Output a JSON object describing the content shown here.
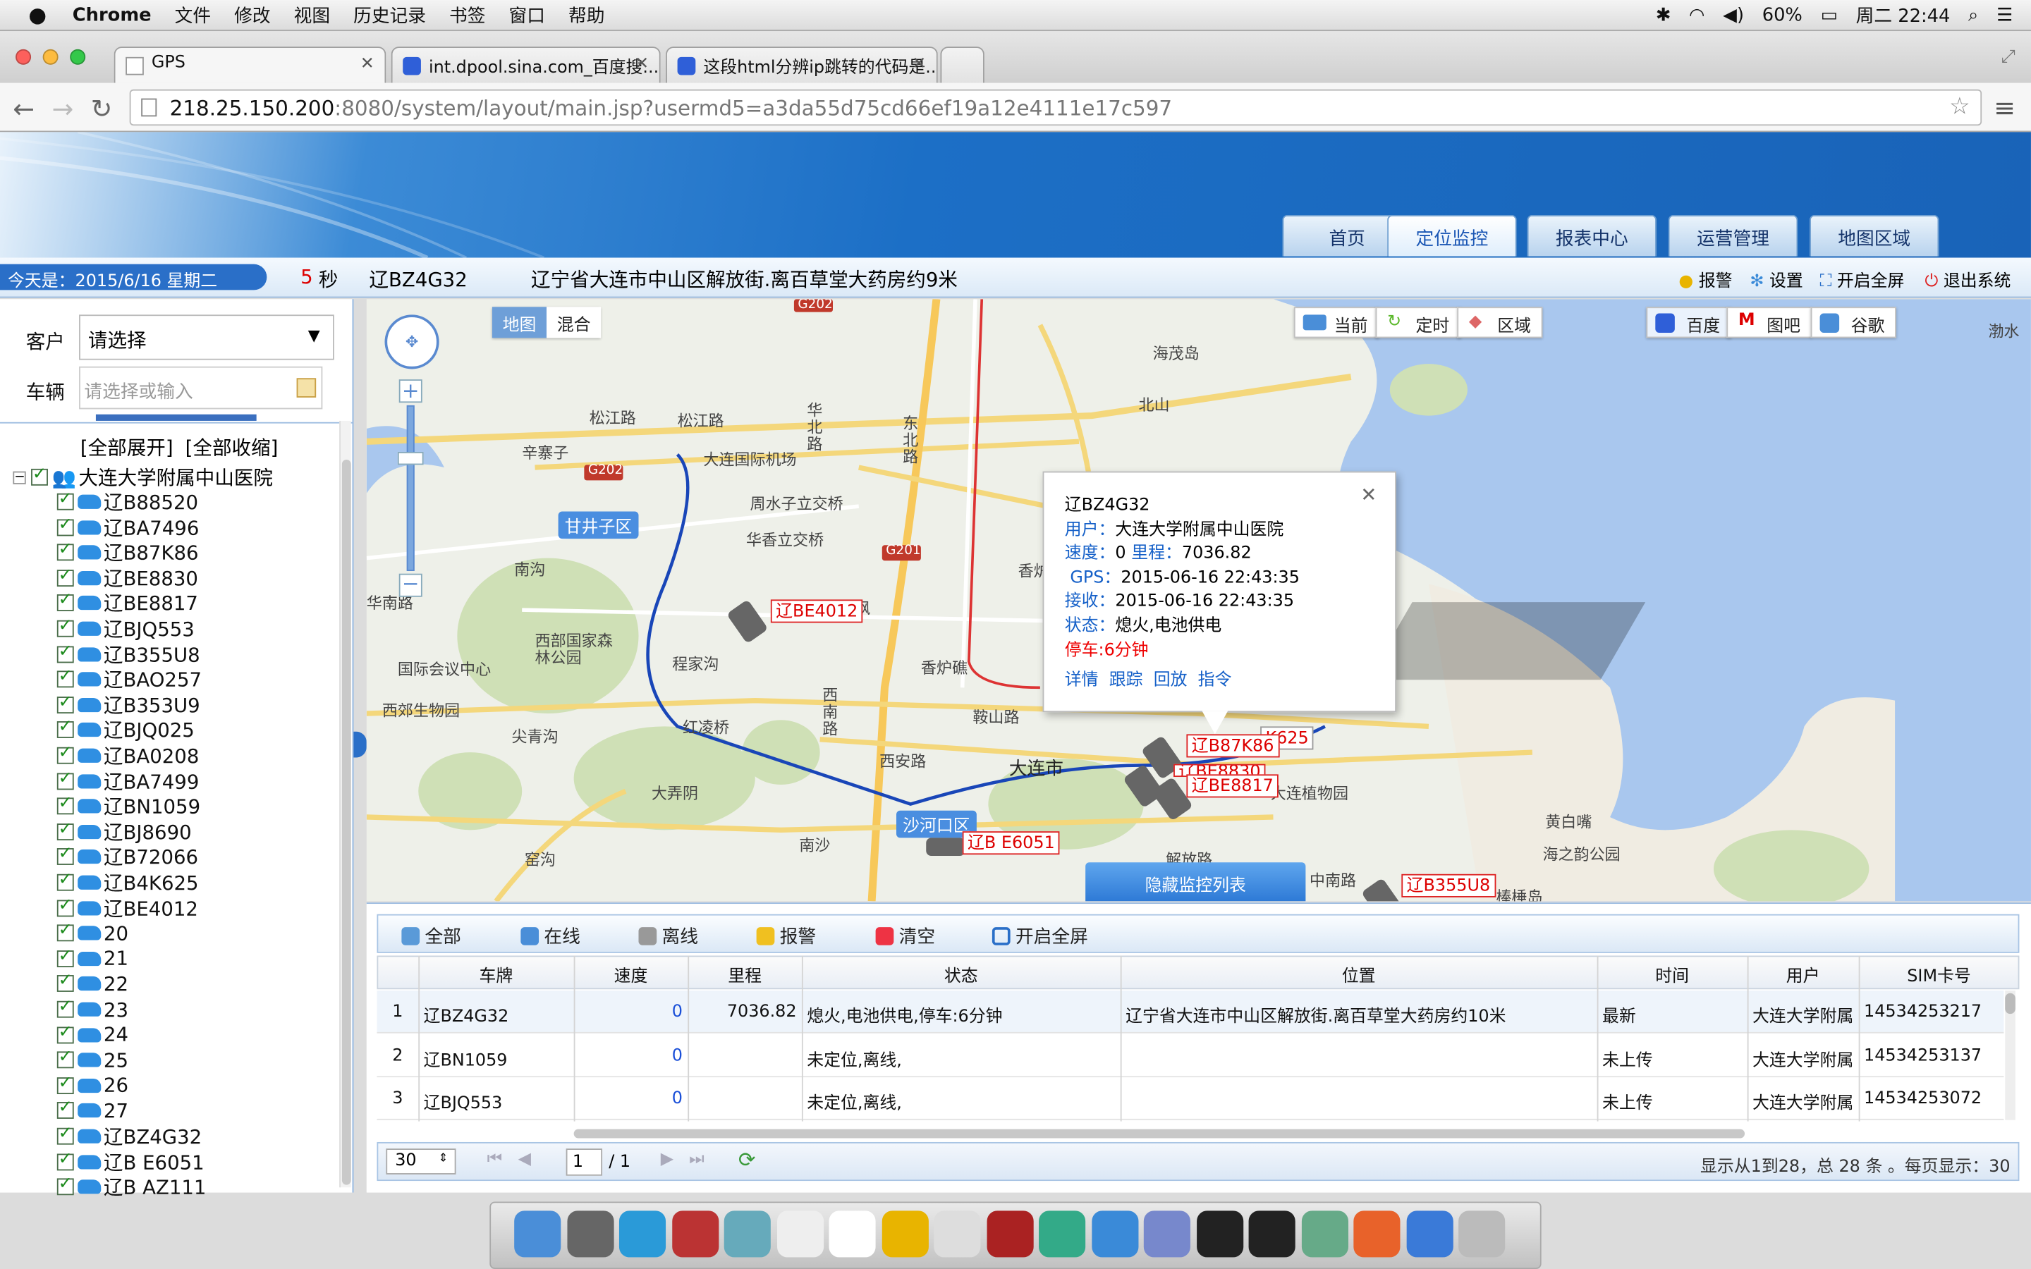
{
  "menubar": {
    "app": "Chrome",
    "items": [
      "文件",
      "修改",
      "视图",
      "历史记录",
      "书签",
      "窗口",
      "帮助"
    ],
    "battery": "60%",
    "clock": "周二 22:44"
  },
  "browser": {
    "tabs": [
      {
        "title": "GPS"
      },
      {
        "title": "int.dpool.sina.com_百度搜..."
      },
      {
        "title": "这段html分辨ip跳转的代码是..."
      }
    ],
    "url_host": "218.25.150.200",
    "url_rest": ":8080/system/layout/main.jsp?usermd5=a3da55d75cd66ef19a12e4111e17c597"
  },
  "nav": {
    "tabs": [
      "首页",
      "定位监控",
      "报表中心",
      "运营管理",
      "地图区域"
    ],
    "active": "定位监控"
  },
  "infobar": {
    "date": "今天是：2015/6/16 星期二",
    "refresh_num": "5",
    "refresh_unit": "秒",
    "plate": "辽BZ4G32",
    "address": "辽宁省大连市中山区解放街.离百草堂大药房约9米",
    "actions": [
      "报警",
      "设置",
      "开启全屏",
      "退出系统"
    ]
  },
  "left": {
    "customer_label": "客户",
    "customer_value": "请选择",
    "vehicle_label": "车辆",
    "vehicle_placeholder": "请选择或输入",
    "expand_all": "[全部展开]",
    "collapse_all": "[全部收缩]",
    "root": "大连大学附属中山医院",
    "vehicles": [
      "辽B88520",
      "辽BA7496",
      "辽B87K86",
      "辽BE8830",
      "辽BE8817",
      "辽BJQ553",
      "辽B355U8",
      "辽BAO257",
      "辽B353U9",
      "辽BJQ025",
      "辽BA0208",
      "辽BA7499",
      "辽BN1059",
      "辽BJ8690",
      "辽B72066",
      "辽B4K625",
      "辽BE4012",
      "20",
      "21",
      "22",
      "23",
      "24",
      "25",
      "26",
      "27",
      "辽BZ4G32",
      "辽B E6051",
      "辽B AZ111"
    ]
  },
  "map": {
    "type_buttons": [
      "地图",
      "混合"
    ],
    "mode_buttons": [
      "当前",
      "定时",
      "区域"
    ],
    "provider_buttons": [
      "百度",
      "图吧",
      "谷歌"
    ],
    "labels": [
      "松江路",
      "松江路",
      "辛寨子",
      "大连国际机场",
      "周水子立交桥",
      "甘井子区",
      "华香立交桥",
      "南沟",
      "西部国家森林公园",
      "国际会议中心",
      "西郊生物园",
      "程家沟",
      "尖青沟",
      "香炉礁",
      "西南路",
      "红凌桥",
      "西安路",
      "鞍山路",
      "大连市",
      "大连植物园",
      "沙河口区",
      "大弄阴",
      "南沙",
      "窑沟",
      "解放路",
      "中南路",
      "海之韵公园",
      "黄白嘴",
      "棒棰岛",
      "北山",
      "海茂岛",
      "渤水",
      "香炉",
      "东北路",
      "华北路",
      "华南路",
      "枫"
    ],
    "plates": [
      "辽BE4012",
      "辽B87K86",
      "辽BE8817",
      "辽B E6051",
      "辽B355U8",
      "K625",
      "辽BE8830"
    ],
    "roads": [
      "G202",
      "G202",
      "G201"
    ],
    "hide_list": "隐藏监控列表"
  },
  "popup": {
    "plate": "辽BZ4G32",
    "user_label": "用户：",
    "user": "大连大学附属中山医院",
    "speed_label": "速度：",
    "speed": "0",
    "mileage_label": "里程：",
    "mileage": "7036.82",
    "gps_label": "GPS：",
    "gps": "2015-06-16 22:43:35",
    "recv_label": "接收：",
    "recv": "2015-06-16 22:43:35",
    "status_label": "状态：",
    "status": "熄火,电池供电",
    "parked": "停车:6分钟",
    "links": [
      "详情",
      "跟踪",
      "回放",
      "指令"
    ]
  },
  "grid": {
    "toolbar": [
      "全部",
      "在线",
      "离线",
      "报警",
      "清空",
      "开启全屏"
    ],
    "headers": [
      "车牌",
      "速度",
      "里程",
      "状态",
      "位置",
      "时间",
      "用户",
      "SIM卡号"
    ],
    "rows": [
      {
        "n": "1",
        "plate": "辽BZ4G32",
        "speed": "0",
        "mileage": "7036.82",
        "status": "熄火,电池供电,停车:6分钟",
        "location": "辽宁省大连市中山区解放街.离百草堂大药房约10米",
        "time": "最新",
        "user": "大连大学附属",
        "sim": "14534253217"
      },
      {
        "n": "2",
        "plate": "辽BN1059",
        "speed": "0",
        "mileage": "",
        "status": "未定位,离线,",
        "location": "",
        "time": "未上传",
        "user": "大连大学附属",
        "sim": "14534253137"
      },
      {
        "n": "3",
        "plate": "辽BJQ553",
        "speed": "0",
        "mileage": "",
        "status": "未定位,离线,",
        "location": "",
        "time": "未上传",
        "user": "大连大学附属",
        "sim": "14534253072"
      }
    ],
    "pager": {
      "per_page": "30",
      "page": "1",
      "total_pages": "/ 1",
      "summary": "显示从1到28，总 28 条 。每页显示：30"
    }
  }
}
